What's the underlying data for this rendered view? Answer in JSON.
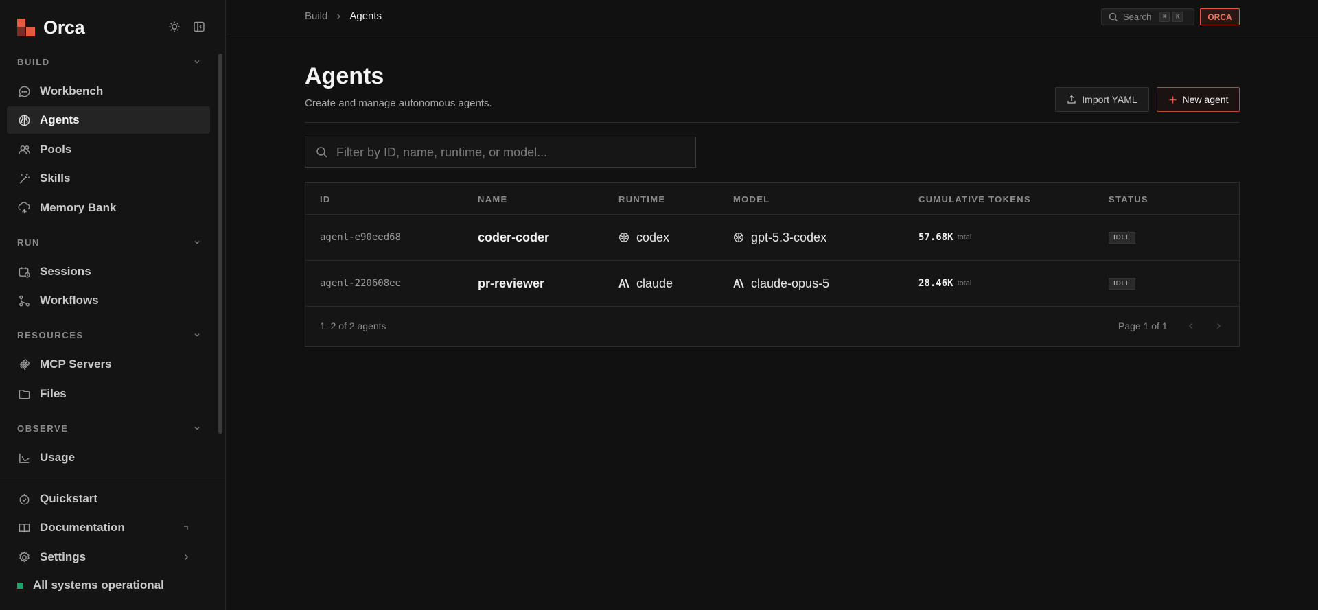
{
  "app": {
    "name": "Orca"
  },
  "sidebar": {
    "sections": {
      "build": "BUILD",
      "run": "RUN",
      "resources": "RESOURCES",
      "observe": "OBSERVE"
    },
    "items": {
      "workbench": "Workbench",
      "agents": "Agents",
      "pools": "Pools",
      "skills": "Skills",
      "memory_bank": "Memory Bank",
      "sessions": "Sessions",
      "workflows": "Workflows",
      "mcp_servers": "MCP Servers",
      "files": "Files",
      "usage": "Usage"
    },
    "footer": {
      "quickstart": "Quickstart",
      "documentation": "Documentation",
      "settings": "Settings",
      "status": "All systems operational"
    },
    "active": "agents"
  },
  "topbar": {
    "breadcrumb": [
      "Build",
      "Agents"
    ],
    "search_label": "Search",
    "search_keys": [
      "⌘",
      "K"
    ],
    "org_badge": "ORCA"
  },
  "page": {
    "title": "Agents",
    "subtitle": "Create and manage autonomous agents.",
    "import_label": "Import YAML",
    "new_label": "New agent",
    "filter_placeholder": "Filter by ID, name, runtime, or model..."
  },
  "table": {
    "columns": [
      "ID",
      "NAME",
      "RUNTIME",
      "MODEL",
      "CUMULATIVE TOKENS",
      "STATUS"
    ],
    "rows": [
      {
        "id": "agent-e90eed68",
        "name": "coder-coder",
        "runtime": "codex",
        "runtime_icon": "openai-icon",
        "model": "gpt-5.3-codex",
        "model_icon": "openai-icon",
        "tokens": "57.68K",
        "tokens_unit": "total",
        "status": "IDLE"
      },
      {
        "id": "agent-220608ee",
        "name": "pr-reviewer",
        "runtime": "claude",
        "runtime_icon": "anthropic-icon",
        "model": "claude-opus-5",
        "model_icon": "anthropic-icon",
        "tokens": "28.46K",
        "tokens_unit": "total",
        "status": "IDLE"
      }
    ],
    "footer_count": "1–2 of 2 agents",
    "pagination": "Page 1 of 1"
  },
  "colors": {
    "accent": "#e8573f",
    "status_ok": "#22a06b",
    "background": "#111111",
    "sidebar": "#141414"
  }
}
